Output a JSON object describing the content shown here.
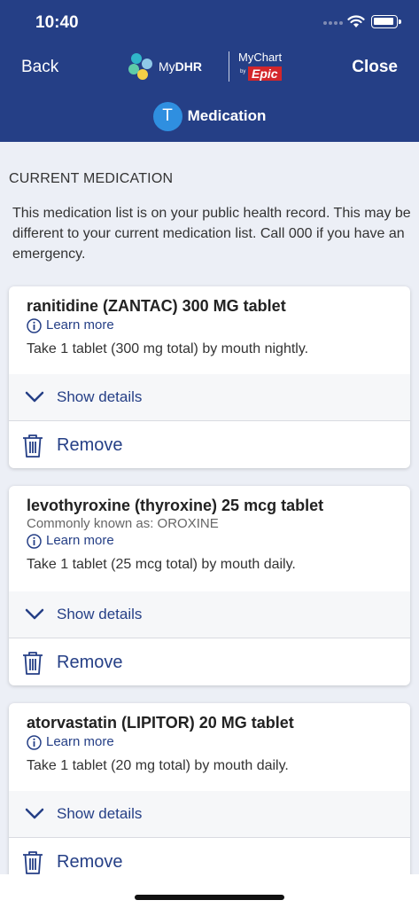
{
  "status_bar": {
    "time": "10:40"
  },
  "nav": {
    "back_label": "Back",
    "close_label": "Close"
  },
  "logos": {
    "mydhr_prefix": "My",
    "mydhr_bold": "DHR",
    "mychart": "MyChart",
    "epic_by": "by",
    "epic": "Epic"
  },
  "header": {
    "avatar_initial": "T",
    "title": "Medication"
  },
  "section": {
    "heading": "CURRENT MEDICATION",
    "disclaimer": "This medication list is on your public health record. This may be different to your current medication list. Call 000 if you have an emergency."
  },
  "medications": [
    {
      "name": "ranitidine (ZANTAC) 300 MG tablet",
      "learn_more": "Learn more",
      "instructions": "Take 1 tablet (300 mg total) by mouth nightly.",
      "show_details": "Show details",
      "remove": "Remove"
    },
    {
      "name": "levothyroxine (thyroxine) 25 mcg tablet",
      "aka": "Commonly known as: OROXINE",
      "learn_more": "Learn more",
      "instructions": "Take 1 tablet (25 mcg total) by mouth daily.",
      "show_details": "Show details",
      "remove": "Remove"
    },
    {
      "name": "atorvastatin (LIPITOR) 20 MG tablet",
      "learn_more": "Learn more",
      "instructions": "Take 1 tablet (20 mg total) by mouth daily.",
      "show_details": "Show details",
      "remove": "Remove"
    }
  ],
  "colors": {
    "header_bg": "#253f86",
    "accent": "#253f86",
    "avatar": "#2f8fe0",
    "epic_red": "#d3262b"
  }
}
